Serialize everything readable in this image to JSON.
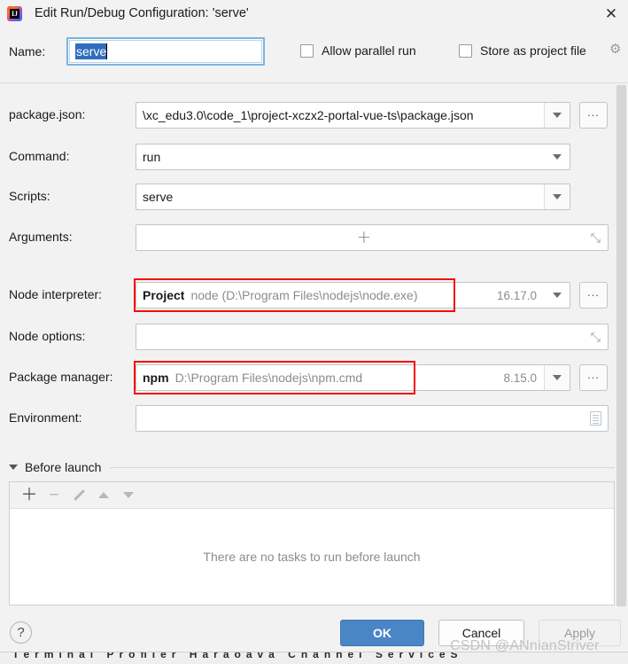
{
  "window": {
    "title": "Edit Run/Debug Configuration: 'serve'",
    "logo_letter": "IJ",
    "close_glyph": "✕"
  },
  "name_row": {
    "label": "Name:",
    "value": "serve",
    "checkboxes": [
      {
        "label": "Allow parallel run",
        "checked": false
      },
      {
        "label": "Store as project file",
        "checked": false
      }
    ],
    "gear_glyph": "⚙"
  },
  "fields": {
    "package_json": {
      "label": "package.json:",
      "value": "\\xc_edu3.0\\code_1\\project-xczx2-portal-vue-ts\\package.json",
      "browse_label": "...",
      "has_dropdown": true,
      "has_browse": true
    },
    "command": {
      "label": "Command:",
      "value": "run",
      "has_dropdown": true,
      "has_browse": false
    },
    "scripts": {
      "label": "Scripts:",
      "value": "serve",
      "has_dropdown": true,
      "has_browse": false
    },
    "arguments": {
      "label": "Arguments:",
      "value": "",
      "plus_glyph": "＋",
      "expand_glyph": "⤡"
    },
    "node_interpreter": {
      "label": "Node interpreter:",
      "scope": "Project",
      "value": "node (D:\\Program Files\\nodejs\\node.exe)",
      "version": "16.17.0",
      "browse_label": "...",
      "highlighted": true,
      "highlight_color": "#f20d0d"
    },
    "node_options": {
      "label": "Node options:",
      "value": "",
      "expand_glyph": "⤡"
    },
    "package_manager": {
      "label": "Package manager:",
      "scope": "npm",
      "value": "D:\\Program Files\\nodejs\\npm.cmd",
      "version": "8.15.0",
      "browse_label": "...",
      "highlighted": true,
      "highlight_color": "#f20d0d"
    },
    "environment": {
      "label": "Environment:",
      "value": "",
      "icon": "env-variables-icon"
    }
  },
  "before_launch": {
    "title": "Before launch",
    "expanded": true,
    "toolbar": [
      {
        "name": "add-task-button",
        "glyph": "＋"
      },
      {
        "name": "remove-task-button",
        "glyph": "−"
      },
      {
        "name": "edit-task-button",
        "glyph": ""
      },
      {
        "name": "move-up-button",
        "glyph": ""
      },
      {
        "name": "move-down-button",
        "glyph": ""
      }
    ],
    "empty_message": "There are no tasks to run before launch"
  },
  "footer": {
    "help_glyph": "?",
    "ok_label": "OK",
    "cancel_label": "Cancel",
    "apply_label": "Apply",
    "apply_disabled": true
  },
  "watermark": "CSDN @ANnianStriver",
  "ide_strip": "Terminal   Proﬁler   Haraoava Channel   ServiceS",
  "colors": {
    "accent": "#4a86c5",
    "selection": "#2f6ebb",
    "annotation": "#f20d0d",
    "dialog_bg": "#f2f2f2"
  }
}
